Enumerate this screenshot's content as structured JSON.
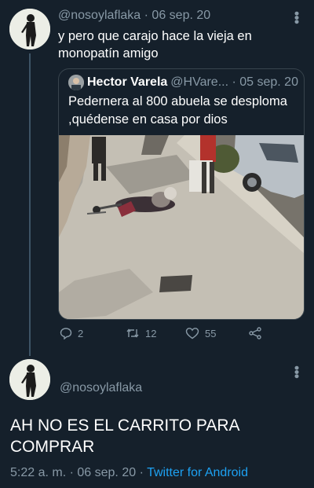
{
  "tweet": {
    "handle": "@nosoylaflaka",
    "date": "06 sep. 20",
    "text": "y pero que carajo hace la vieja en monopatín amigo"
  },
  "quoted": {
    "name": "Hector Varela",
    "handle": "@HVare...",
    "date": "05 sep. 20",
    "text": "Pedernera al 800 abuela se desploma ,quédense en casa por dios"
  },
  "actions": {
    "replies": "2",
    "retweets": "12",
    "likes": "55"
  },
  "reply": {
    "handle": "@nosoylaflaka",
    "text": "AH NO ES EL CARRITO PARA COMPRAR",
    "time": "5:22 a. m.",
    "date": "06 sep. 20",
    "source": "Twitter for Android"
  },
  "colors": {
    "background": "#15202b",
    "secondary_text": "#8899a6",
    "link": "#1da1f2",
    "border": "#38444d"
  },
  "icons": [
    "more-options-icon",
    "reply-icon",
    "retweet-icon",
    "like-icon",
    "share-icon"
  ]
}
